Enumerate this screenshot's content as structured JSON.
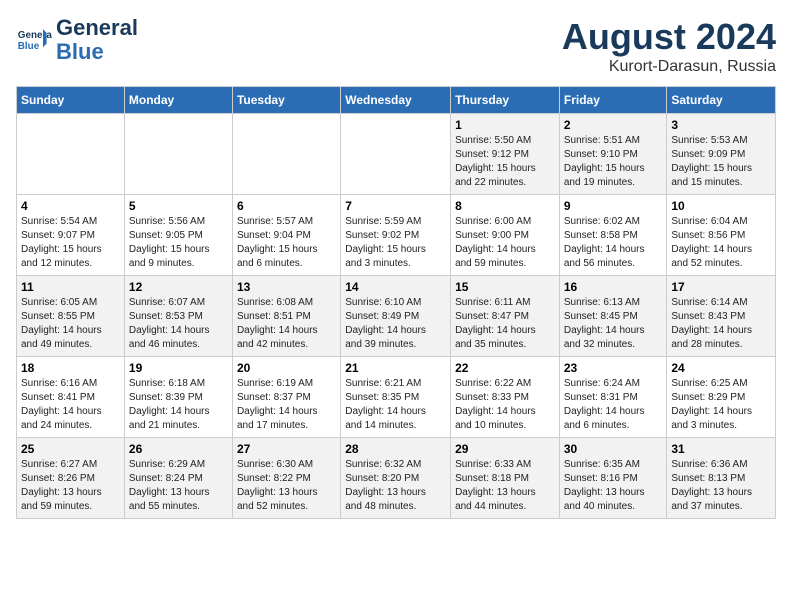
{
  "header": {
    "logo_line1": "General",
    "logo_line2": "Blue",
    "month_year": "August 2024",
    "location": "Kurort-Darasun, Russia"
  },
  "weekdays": [
    "Sunday",
    "Monday",
    "Tuesday",
    "Wednesday",
    "Thursday",
    "Friday",
    "Saturday"
  ],
  "weeks": [
    [
      {
        "day": "",
        "info": ""
      },
      {
        "day": "",
        "info": ""
      },
      {
        "day": "",
        "info": ""
      },
      {
        "day": "",
        "info": ""
      },
      {
        "day": "1",
        "info": "Sunrise: 5:50 AM\nSunset: 9:12 PM\nDaylight: 15 hours\nand 22 minutes."
      },
      {
        "day": "2",
        "info": "Sunrise: 5:51 AM\nSunset: 9:10 PM\nDaylight: 15 hours\nand 19 minutes."
      },
      {
        "day": "3",
        "info": "Sunrise: 5:53 AM\nSunset: 9:09 PM\nDaylight: 15 hours\nand 15 minutes."
      }
    ],
    [
      {
        "day": "4",
        "info": "Sunrise: 5:54 AM\nSunset: 9:07 PM\nDaylight: 15 hours\nand 12 minutes."
      },
      {
        "day": "5",
        "info": "Sunrise: 5:56 AM\nSunset: 9:05 PM\nDaylight: 15 hours\nand 9 minutes."
      },
      {
        "day": "6",
        "info": "Sunrise: 5:57 AM\nSunset: 9:04 PM\nDaylight: 15 hours\nand 6 minutes."
      },
      {
        "day": "7",
        "info": "Sunrise: 5:59 AM\nSunset: 9:02 PM\nDaylight: 15 hours\nand 3 minutes."
      },
      {
        "day": "8",
        "info": "Sunrise: 6:00 AM\nSunset: 9:00 PM\nDaylight: 14 hours\nand 59 minutes."
      },
      {
        "day": "9",
        "info": "Sunrise: 6:02 AM\nSunset: 8:58 PM\nDaylight: 14 hours\nand 56 minutes."
      },
      {
        "day": "10",
        "info": "Sunrise: 6:04 AM\nSunset: 8:56 PM\nDaylight: 14 hours\nand 52 minutes."
      }
    ],
    [
      {
        "day": "11",
        "info": "Sunrise: 6:05 AM\nSunset: 8:55 PM\nDaylight: 14 hours\nand 49 minutes."
      },
      {
        "day": "12",
        "info": "Sunrise: 6:07 AM\nSunset: 8:53 PM\nDaylight: 14 hours\nand 46 minutes."
      },
      {
        "day": "13",
        "info": "Sunrise: 6:08 AM\nSunset: 8:51 PM\nDaylight: 14 hours\nand 42 minutes."
      },
      {
        "day": "14",
        "info": "Sunrise: 6:10 AM\nSunset: 8:49 PM\nDaylight: 14 hours\nand 39 minutes."
      },
      {
        "day": "15",
        "info": "Sunrise: 6:11 AM\nSunset: 8:47 PM\nDaylight: 14 hours\nand 35 minutes."
      },
      {
        "day": "16",
        "info": "Sunrise: 6:13 AM\nSunset: 8:45 PM\nDaylight: 14 hours\nand 32 minutes."
      },
      {
        "day": "17",
        "info": "Sunrise: 6:14 AM\nSunset: 8:43 PM\nDaylight: 14 hours\nand 28 minutes."
      }
    ],
    [
      {
        "day": "18",
        "info": "Sunrise: 6:16 AM\nSunset: 8:41 PM\nDaylight: 14 hours\nand 24 minutes."
      },
      {
        "day": "19",
        "info": "Sunrise: 6:18 AM\nSunset: 8:39 PM\nDaylight: 14 hours\nand 21 minutes."
      },
      {
        "day": "20",
        "info": "Sunrise: 6:19 AM\nSunset: 8:37 PM\nDaylight: 14 hours\nand 17 minutes."
      },
      {
        "day": "21",
        "info": "Sunrise: 6:21 AM\nSunset: 8:35 PM\nDaylight: 14 hours\nand 14 minutes."
      },
      {
        "day": "22",
        "info": "Sunrise: 6:22 AM\nSunset: 8:33 PM\nDaylight: 14 hours\nand 10 minutes."
      },
      {
        "day": "23",
        "info": "Sunrise: 6:24 AM\nSunset: 8:31 PM\nDaylight: 14 hours\nand 6 minutes."
      },
      {
        "day": "24",
        "info": "Sunrise: 6:25 AM\nSunset: 8:29 PM\nDaylight: 14 hours\nand 3 minutes."
      }
    ],
    [
      {
        "day": "25",
        "info": "Sunrise: 6:27 AM\nSunset: 8:26 PM\nDaylight: 13 hours\nand 59 minutes."
      },
      {
        "day": "26",
        "info": "Sunrise: 6:29 AM\nSunset: 8:24 PM\nDaylight: 13 hours\nand 55 minutes."
      },
      {
        "day": "27",
        "info": "Sunrise: 6:30 AM\nSunset: 8:22 PM\nDaylight: 13 hours\nand 52 minutes."
      },
      {
        "day": "28",
        "info": "Sunrise: 6:32 AM\nSunset: 8:20 PM\nDaylight: 13 hours\nand 48 minutes."
      },
      {
        "day": "29",
        "info": "Sunrise: 6:33 AM\nSunset: 8:18 PM\nDaylight: 13 hours\nand 44 minutes."
      },
      {
        "day": "30",
        "info": "Sunrise: 6:35 AM\nSunset: 8:16 PM\nDaylight: 13 hours\nand 40 minutes."
      },
      {
        "day": "31",
        "info": "Sunrise: 6:36 AM\nSunset: 8:13 PM\nDaylight: 13 hours\nand 37 minutes."
      }
    ]
  ]
}
